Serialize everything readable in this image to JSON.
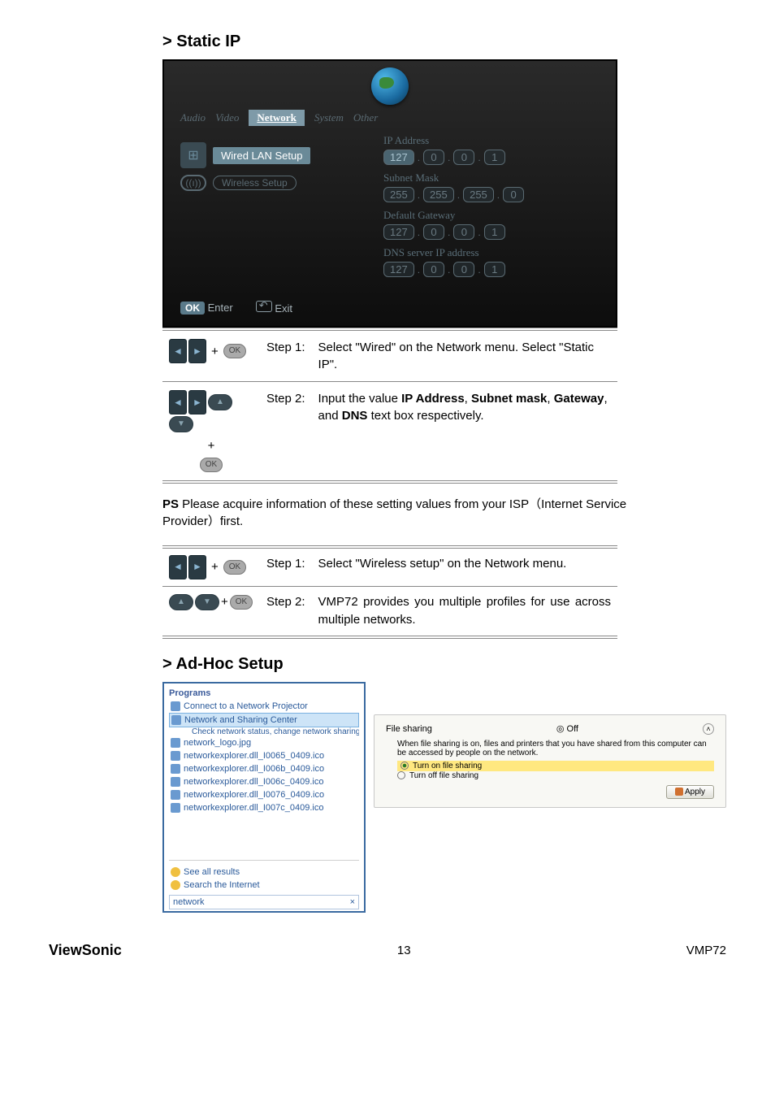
{
  "section1_title": "> Static IP",
  "tv": {
    "tabs": {
      "audio": "Audio",
      "video": "Video",
      "network": "Network",
      "system": "System",
      "other": "Other"
    },
    "wired_label": "Wired LAN Setup",
    "wireless_label": "Wireless Setup",
    "fields": {
      "ip": {
        "label": "IP Address",
        "o1": "127",
        "o2": "0",
        "o3": "0",
        "o4": "1"
      },
      "mask": {
        "label": "Subnet Mask",
        "o1": "255",
        "o2": "255",
        "o3": "255",
        "o4": "0"
      },
      "gw": {
        "label": "Default Gateway",
        "o1": "127",
        "o2": "0",
        "o3": "0",
        "o4": "1"
      },
      "dns": {
        "label": "DNS server IP address",
        "o1": "127",
        "o2": "0",
        "o3": "0",
        "o4": "1"
      }
    },
    "ok": "OK",
    "enter": "Enter",
    "exit": "Exit"
  },
  "steps1": {
    "s1_label": "Step 1:",
    "s1_text": "Select \"Wired\" on the Network menu. Select \"Static IP\".",
    "s2_label": "Step 2:",
    "s2_prefix": "Input the value ",
    "s2_b1": "IP Address",
    "s2_mid1": ", ",
    "s2_b2": "Subnet mask",
    "s2_mid2": ", ",
    "s2_b3": "Gateway",
    "s2_mid3": ", and ",
    "s2_b4": "DNS",
    "s2_suffix": " text box respectively."
  },
  "ps": {
    "b": "PS",
    "text": " Please acquire information of these setting values from your ISP（Internet Service Provider）first."
  },
  "steps2": {
    "s1_label": "Step 1:",
    "s1_text": "Select \"Wireless setup\" on the Network menu.",
    "s2_label": "Step 2:",
    "s2_text": "VMP72 provides you multiple profiles for use across multiple networks."
  },
  "section2_title": "> Ad-Hoc Setup",
  "win": {
    "programs": "Programs",
    "items": [
      "Connect to a Network Projector",
      "Network and Sharing Center",
      "Check network status, change network sharing files and printers.",
      "network_logo.jpg",
      "networkexplorer.dll_I0065_0409.ico",
      "networkexplorer.dll_I006b_0409.ico",
      "networkexplorer.dll_I006c_0409.ico",
      "networkexplorer.dll_I0076_0409.ico",
      "networkexplorer.dll_I007c_0409.ico"
    ],
    "see_all": "See all results",
    "search_internet": "Search the Internet",
    "searchbox": "network",
    "close": "×"
  },
  "fs": {
    "title": "File sharing",
    "status_symbol": "◎",
    "status": "Off",
    "caret": "˄",
    "desc": "When file sharing is on, files and printers that you have shared from this computer can be accessed by people on the network.",
    "opt_on": "Turn on file sharing",
    "opt_off": "Turn off file sharing",
    "apply": "Apply"
  },
  "footer": {
    "brand": "ViewSonic",
    "page": "13",
    "model": "VMP72"
  },
  "glyphs": {
    "plus": "+",
    "ok": "OK",
    "left": "◄",
    "right": "►",
    "up": "▲",
    "down": "▼"
  }
}
